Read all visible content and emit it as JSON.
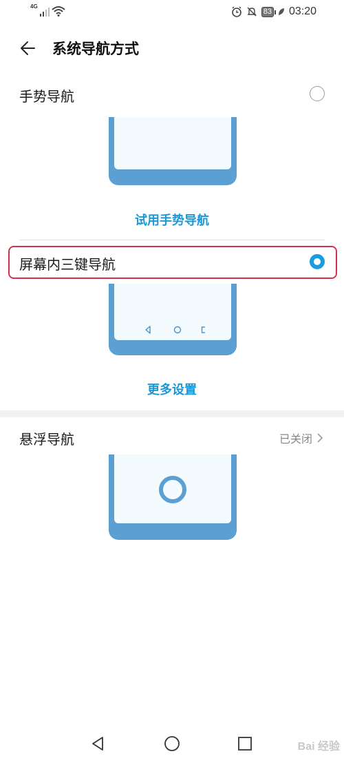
{
  "status_bar": {
    "network": "4G",
    "battery": "83",
    "time": "03:20"
  },
  "header": {
    "title": "系统导航方式"
  },
  "options": {
    "gesture": {
      "label": "手势导航",
      "selected": false,
      "link": "试用手势导航"
    },
    "three_key": {
      "label": "屏幕内三键导航",
      "selected": true,
      "link": "更多设置"
    },
    "float": {
      "label": "悬浮导航",
      "status": "已关闭"
    }
  },
  "colors": {
    "accent": "#1a9de0",
    "link": "#1f97d6",
    "phone_frame": "#5b9fd3",
    "highlight": "#d4324a"
  },
  "watermark": "Bai 经验",
  "icons": [
    "back-arrow-icon",
    "chevron-right-icon",
    "nav-back-icon",
    "nav-home-icon",
    "nav-recents-icon",
    "alarm-icon",
    "mute-icon",
    "wifi-icon",
    "signal-icon"
  ]
}
